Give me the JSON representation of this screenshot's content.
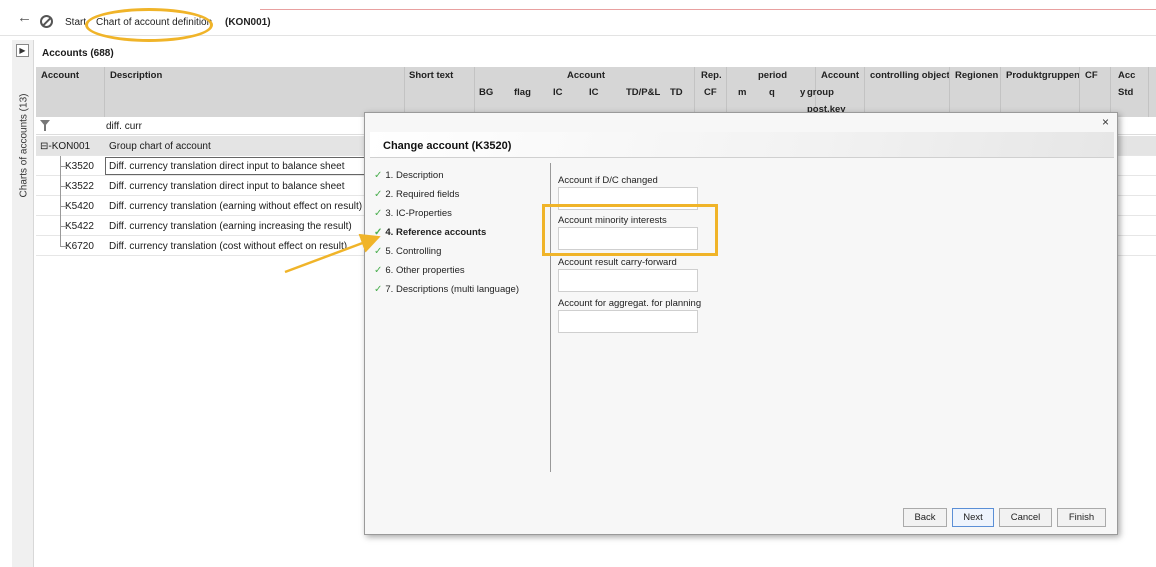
{
  "topbar": {
    "back_icon": "back-arrow-icon",
    "cancel_icon": "cancel-icon",
    "crumb_start": "Start",
    "crumb_sep": "-",
    "crumb_coa": "Chart of account definition",
    "crumb_code": "(KON001)"
  },
  "sidebar": {
    "toggle_icon": "expand-panel-icon",
    "label": "Charts of accounts (13)"
  },
  "grid": {
    "title": "Accounts (688)",
    "headers": {
      "account": "Account",
      "description": "Description",
      "short_text": "Short text",
      "account_group": "Account",
      "bg": "BG",
      "flag": "flag",
      "ic1": "IC",
      "ic2": "IC",
      "tdpl": "TD/P&L",
      "td": "TD",
      "rep": "Rep.",
      "cf": "CF",
      "period": "period",
      "m": "m",
      "q": "q",
      "y": "y",
      "acc_group_1": "Account",
      "acc_group_2": "group",
      "acc_group_3": "post.key",
      "controlling": "controlling object",
      "regionen": "Regionen",
      "produktgruppen": "Produktgruppen",
      "cf2": "CF",
      "acc_std_1": "Acc",
      "acc_std_2": "Std"
    },
    "filter": {
      "icon": "filter-icon",
      "value": "diff. curr"
    },
    "rows": [
      {
        "account": "⊟-KON001",
        "description": "Group chart of account"
      },
      {
        "account": "K3520",
        "description": "Diff. currency translation direct input to balance sheet"
      },
      {
        "account": "K3522",
        "description": "Diff. currency translation direct input to balance sheet"
      },
      {
        "account": "K5420",
        "description": "Diff. currency translation (earning without effect on result)"
      },
      {
        "account": "K5422",
        "description": "Diff. currency translation (earning increasing the result)"
      },
      {
        "account": "K6720",
        "description": "Diff. currency translation (cost without effect on result)"
      }
    ]
  },
  "modal": {
    "title": "Change account (K3520)",
    "close": "×",
    "check": "✓",
    "steps": [
      "1. Description",
      "2. Required fields",
      "3. IC-Properties",
      "4. Reference accounts",
      "5. Controlling",
      "6. Other properties",
      "7. Descriptions (multi language)"
    ],
    "fields": [
      {
        "label": "Account if D/C changed",
        "value": ""
      },
      {
        "label": "Account minority interests",
        "value": ""
      },
      {
        "label": "Account result carry-forward",
        "value": ""
      },
      {
        "label": "Account for aggregat. for planning",
        "value": ""
      }
    ],
    "buttons": {
      "back": "Back",
      "next": "Next",
      "cancel": "Cancel",
      "finish": "Finish"
    }
  },
  "colors": {
    "highlight": "#f0b429",
    "check": "#4caf50",
    "header_bg": "#d6d6d6"
  }
}
